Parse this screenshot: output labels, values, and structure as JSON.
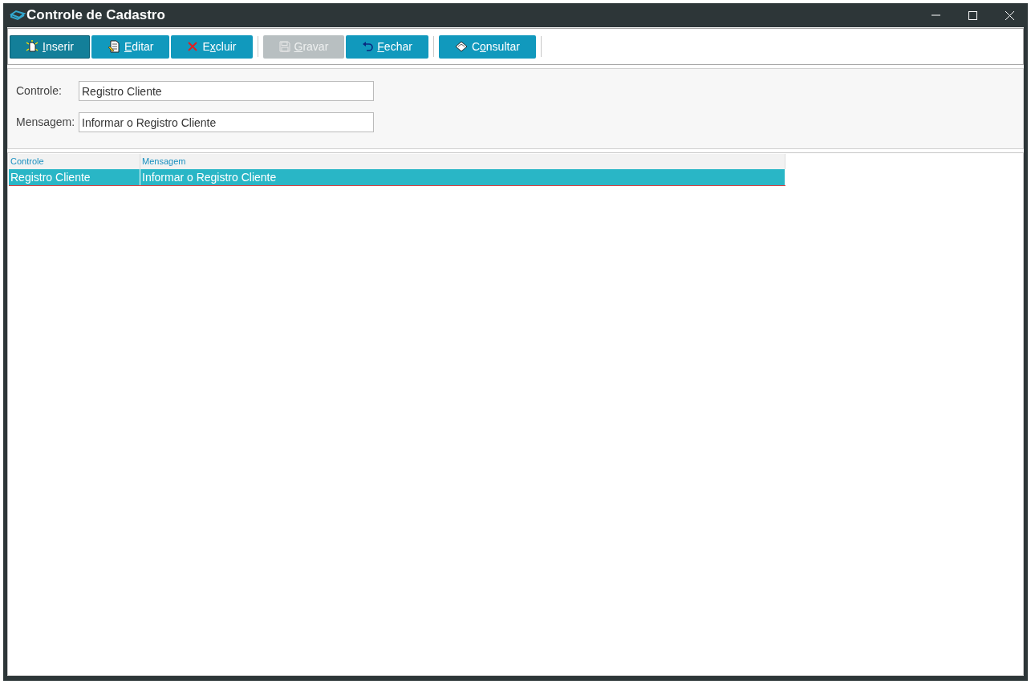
{
  "window": {
    "title": "Controle de Cadastro"
  },
  "toolbar_groups": [
    [
      {
        "key": "I",
        "post": "nserir",
        "active": true,
        "disabled": false
      },
      {
        "key": "E",
        "post": "ditar",
        "active": false,
        "disabled": false
      },
      {
        "pre": "E",
        "key": "x",
        "post": "cluir",
        "active": false,
        "disabled": false
      }
    ],
    [
      {
        "key": "G",
        "post": "ravar",
        "active": false,
        "disabled": true
      },
      {
        "key": "F",
        "post": "echar",
        "active": false,
        "disabled": false
      }
    ],
    [
      {
        "pre": "C",
        "key": "o",
        "post": "nsultar",
        "active": false,
        "disabled": false
      }
    ]
  ],
  "form": [
    {
      "label": "Controle:",
      "value": "Registro Cliente"
    },
    {
      "label": "Mensagem:",
      "value": "Informar o Registro Cliente"
    }
  ],
  "table": {
    "columns": [
      "Controle",
      "Mensagem"
    ],
    "rows": [
      {
        "cells": [
          "Registro Cliente",
          "Informar o Registro Cliente"
        ],
        "selected": true
      }
    ]
  }
}
